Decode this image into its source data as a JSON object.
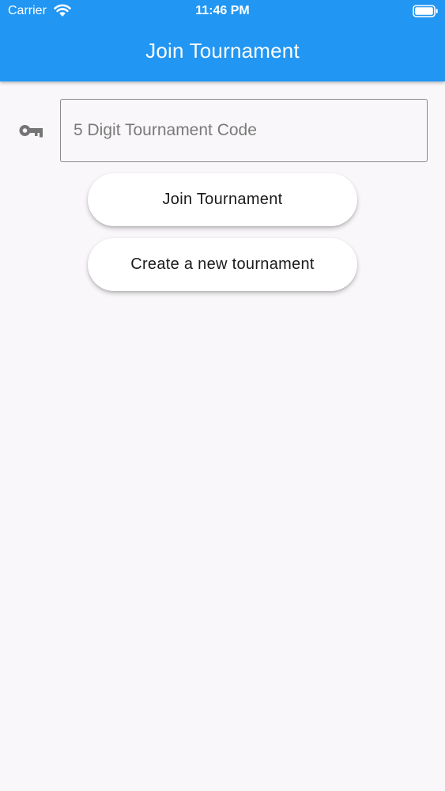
{
  "status_bar": {
    "carrier": "Carrier",
    "time": "11:46 PM"
  },
  "header": {
    "title": "Join Tournament"
  },
  "form": {
    "code_placeholder": "5 Digit Tournament Code",
    "code_value": "",
    "join_label": "Join Tournament",
    "create_label": "Create a new tournament"
  },
  "colors": {
    "app_bar": "#2196f3",
    "background": "#f9f7f9",
    "icon_grey": "#757575"
  },
  "icons": {
    "wifi": "wifi-icon",
    "battery": "battery-icon",
    "key": "key-icon"
  }
}
